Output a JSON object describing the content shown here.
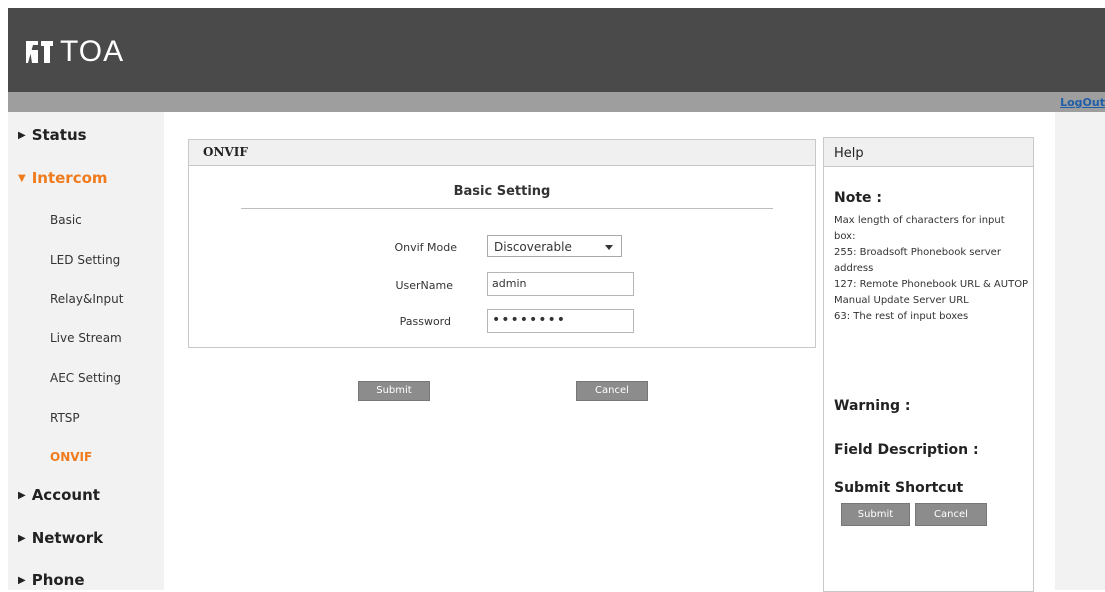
{
  "brand": {
    "logo_text": "TOA"
  },
  "header": {
    "logout": "LogOut"
  },
  "sidebar": {
    "status": "Status",
    "intercom": "Intercom",
    "sub_items": [
      "Basic",
      "LED Setting",
      "Relay&Input",
      "Live Stream",
      "AEC Setting",
      "RTSP",
      "ONVIF"
    ],
    "account": "Account",
    "network": "Network",
    "phone": "Phone"
  },
  "panel": {
    "title": "ONVIF",
    "section": "Basic Setting",
    "onvif_mode_label": "Onvif Mode",
    "onvif_mode_value": "Discoverable",
    "username_label": "UserName",
    "username_value": "admin",
    "password_label": "Password",
    "password_value": "••••••••"
  },
  "actions": {
    "submit": "Submit",
    "cancel": "Cancel"
  },
  "help": {
    "title": "Help",
    "note_heading": "Note :",
    "note_text": "Max length of characters for input box:\n255: Broadsoft Phonebook server address\n127: Remote Phonebook URL & AUTOP Manual Update Server URL\n63: The rest of input boxes",
    "warning_heading": "Warning :",
    "field_heading": "Field Description :",
    "shortcut_heading": "Submit Shortcut",
    "shortcut_submit": "Submit",
    "shortcut_cancel": "Cancel"
  },
  "colors": {
    "accent": "#f07b1d",
    "topbar": "#4a4a4a",
    "subbar": "#9e9e9e",
    "button": "#8c8c8c"
  }
}
